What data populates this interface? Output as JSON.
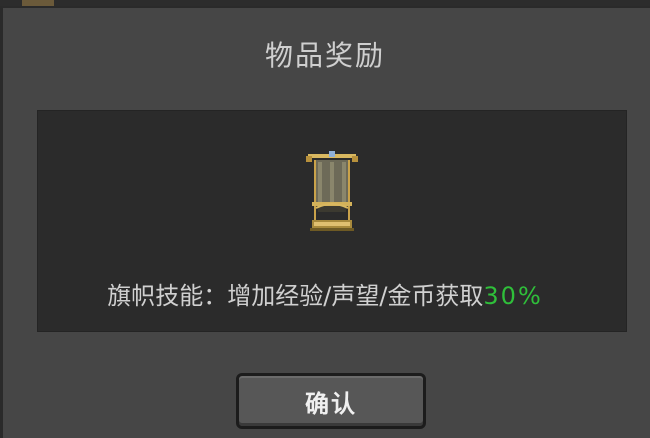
{
  "dialog": {
    "title": "物品奖励",
    "item_icon": "banner-icon",
    "description_prefix": "旗帜技能：增加经验/声望/金币获取",
    "description_value": "30%",
    "confirm_label": "确认"
  },
  "colors": {
    "background": "#464646",
    "panel": "#2b2b2b",
    "highlight": "#2fbf3a"
  }
}
